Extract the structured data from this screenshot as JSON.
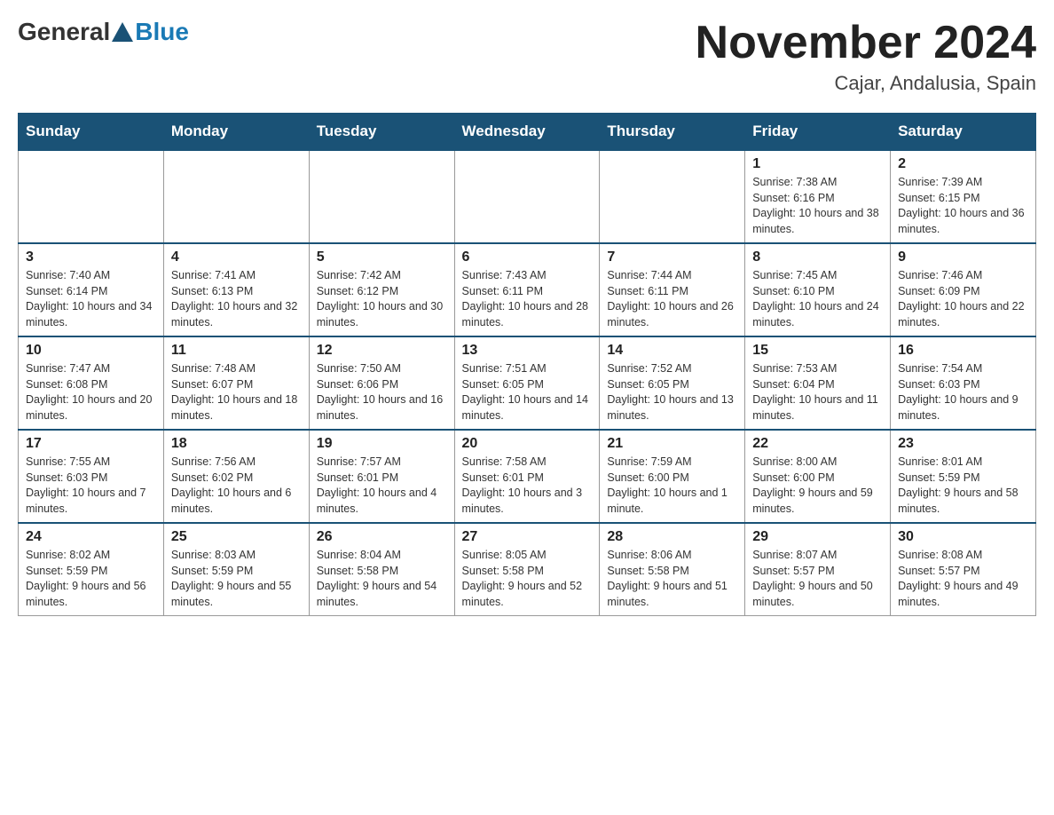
{
  "header": {
    "logo_general": "General",
    "logo_blue": "Blue",
    "title": "November 2024",
    "subtitle": "Cajar, Andalusia, Spain"
  },
  "weekdays": [
    "Sunday",
    "Monday",
    "Tuesday",
    "Wednesday",
    "Thursday",
    "Friday",
    "Saturday"
  ],
  "weeks": [
    [
      {
        "day": "",
        "info": ""
      },
      {
        "day": "",
        "info": ""
      },
      {
        "day": "",
        "info": ""
      },
      {
        "day": "",
        "info": ""
      },
      {
        "day": "",
        "info": ""
      },
      {
        "day": "1",
        "info": "Sunrise: 7:38 AM\nSunset: 6:16 PM\nDaylight: 10 hours and 38 minutes."
      },
      {
        "day": "2",
        "info": "Sunrise: 7:39 AM\nSunset: 6:15 PM\nDaylight: 10 hours and 36 minutes."
      }
    ],
    [
      {
        "day": "3",
        "info": "Sunrise: 7:40 AM\nSunset: 6:14 PM\nDaylight: 10 hours and 34 minutes."
      },
      {
        "day": "4",
        "info": "Sunrise: 7:41 AM\nSunset: 6:13 PM\nDaylight: 10 hours and 32 minutes."
      },
      {
        "day": "5",
        "info": "Sunrise: 7:42 AM\nSunset: 6:12 PM\nDaylight: 10 hours and 30 minutes."
      },
      {
        "day": "6",
        "info": "Sunrise: 7:43 AM\nSunset: 6:11 PM\nDaylight: 10 hours and 28 minutes."
      },
      {
        "day": "7",
        "info": "Sunrise: 7:44 AM\nSunset: 6:11 PM\nDaylight: 10 hours and 26 minutes."
      },
      {
        "day": "8",
        "info": "Sunrise: 7:45 AM\nSunset: 6:10 PM\nDaylight: 10 hours and 24 minutes."
      },
      {
        "day": "9",
        "info": "Sunrise: 7:46 AM\nSunset: 6:09 PM\nDaylight: 10 hours and 22 minutes."
      }
    ],
    [
      {
        "day": "10",
        "info": "Sunrise: 7:47 AM\nSunset: 6:08 PM\nDaylight: 10 hours and 20 minutes."
      },
      {
        "day": "11",
        "info": "Sunrise: 7:48 AM\nSunset: 6:07 PM\nDaylight: 10 hours and 18 minutes."
      },
      {
        "day": "12",
        "info": "Sunrise: 7:50 AM\nSunset: 6:06 PM\nDaylight: 10 hours and 16 minutes."
      },
      {
        "day": "13",
        "info": "Sunrise: 7:51 AM\nSunset: 6:05 PM\nDaylight: 10 hours and 14 minutes."
      },
      {
        "day": "14",
        "info": "Sunrise: 7:52 AM\nSunset: 6:05 PM\nDaylight: 10 hours and 13 minutes."
      },
      {
        "day": "15",
        "info": "Sunrise: 7:53 AM\nSunset: 6:04 PM\nDaylight: 10 hours and 11 minutes."
      },
      {
        "day": "16",
        "info": "Sunrise: 7:54 AM\nSunset: 6:03 PM\nDaylight: 10 hours and 9 minutes."
      }
    ],
    [
      {
        "day": "17",
        "info": "Sunrise: 7:55 AM\nSunset: 6:03 PM\nDaylight: 10 hours and 7 minutes."
      },
      {
        "day": "18",
        "info": "Sunrise: 7:56 AM\nSunset: 6:02 PM\nDaylight: 10 hours and 6 minutes."
      },
      {
        "day": "19",
        "info": "Sunrise: 7:57 AM\nSunset: 6:01 PM\nDaylight: 10 hours and 4 minutes."
      },
      {
        "day": "20",
        "info": "Sunrise: 7:58 AM\nSunset: 6:01 PM\nDaylight: 10 hours and 3 minutes."
      },
      {
        "day": "21",
        "info": "Sunrise: 7:59 AM\nSunset: 6:00 PM\nDaylight: 10 hours and 1 minute."
      },
      {
        "day": "22",
        "info": "Sunrise: 8:00 AM\nSunset: 6:00 PM\nDaylight: 9 hours and 59 minutes."
      },
      {
        "day": "23",
        "info": "Sunrise: 8:01 AM\nSunset: 5:59 PM\nDaylight: 9 hours and 58 minutes."
      }
    ],
    [
      {
        "day": "24",
        "info": "Sunrise: 8:02 AM\nSunset: 5:59 PM\nDaylight: 9 hours and 56 minutes."
      },
      {
        "day": "25",
        "info": "Sunrise: 8:03 AM\nSunset: 5:59 PM\nDaylight: 9 hours and 55 minutes."
      },
      {
        "day": "26",
        "info": "Sunrise: 8:04 AM\nSunset: 5:58 PM\nDaylight: 9 hours and 54 minutes."
      },
      {
        "day": "27",
        "info": "Sunrise: 8:05 AM\nSunset: 5:58 PM\nDaylight: 9 hours and 52 minutes."
      },
      {
        "day": "28",
        "info": "Sunrise: 8:06 AM\nSunset: 5:58 PM\nDaylight: 9 hours and 51 minutes."
      },
      {
        "day": "29",
        "info": "Sunrise: 8:07 AM\nSunset: 5:57 PM\nDaylight: 9 hours and 50 minutes."
      },
      {
        "day": "30",
        "info": "Sunrise: 8:08 AM\nSunset: 5:57 PM\nDaylight: 9 hours and 49 minutes."
      }
    ]
  ]
}
